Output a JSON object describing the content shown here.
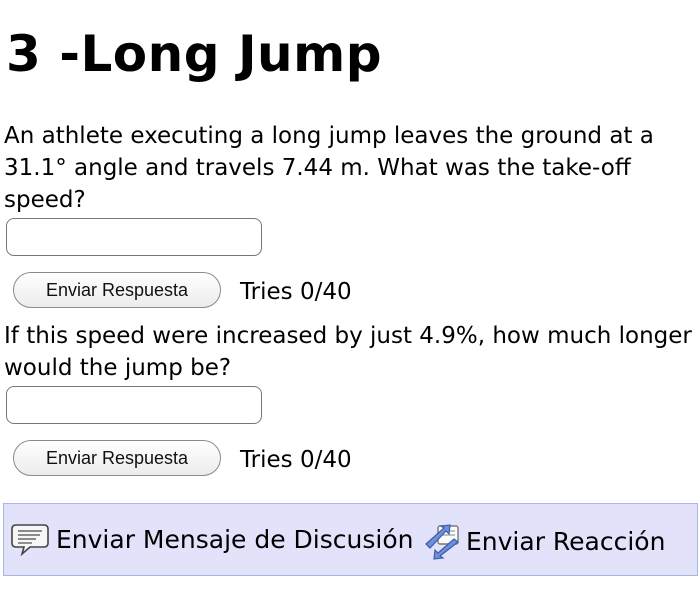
{
  "problem": {
    "title": "3 -Long Jump",
    "question1": "An athlete executing a long jump leaves the ground at a 31.1° angle and travels 7.44 m. What was the take-off speed?",
    "question2": "If this speed were increased by just 4.9%, how much longer would the jump be?"
  },
  "answers": [
    {
      "value": "",
      "submit_label": "Enviar Respuesta",
      "tries": "Tries 0/40"
    },
    {
      "value": "",
      "submit_label": "Enviar Respuesta",
      "tries": "Tries 0/40"
    }
  ],
  "footer": {
    "discussion_label": "Enviar Mensaje de Discusión",
    "discussion_icon": "speech-bubble-icon",
    "reaction_label": "Enviar Reacción",
    "reaction_icon": "reaction-arrows-icon",
    "background": "#e2e2fa",
    "border": "#a7b7e3"
  }
}
